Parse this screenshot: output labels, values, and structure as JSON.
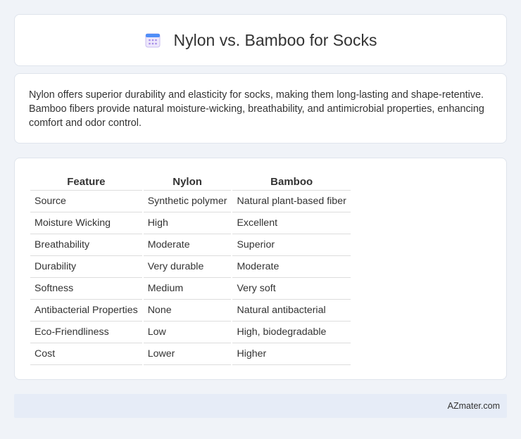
{
  "header": {
    "title": "Nylon vs. Bamboo for Socks",
    "icon": "calendar-icon"
  },
  "summary": {
    "text": "Nylon offers superior durability and elasticity for socks, making them long-lasting and shape-retentive. Bamboo fibers provide natural moisture-wicking, breathability, and antimicrobial properties, enhancing comfort and odor control."
  },
  "table": {
    "headers": [
      "Feature",
      "Nylon",
      "Bamboo"
    ],
    "rows": [
      [
        "Source",
        "Synthetic polymer",
        "Natural plant-based fiber"
      ],
      [
        "Moisture Wicking",
        "High",
        "Excellent"
      ],
      [
        "Breathability",
        "Moderate",
        "Superior"
      ],
      [
        "Durability",
        "Very durable",
        "Moderate"
      ],
      [
        "Softness",
        "Medium",
        "Very soft"
      ],
      [
        "Antibacterial Properties",
        "None",
        "Natural antibacterial"
      ],
      [
        "Eco-Friendliness",
        "Low",
        "High, biodegradable"
      ],
      [
        "Cost",
        "Lower",
        "Higher"
      ]
    ]
  },
  "footer": {
    "brand": "AZmater.com"
  },
  "colors": {
    "background": "#f0f3f8",
    "card": "#ffffff",
    "footer": "#e6ecf7"
  }
}
